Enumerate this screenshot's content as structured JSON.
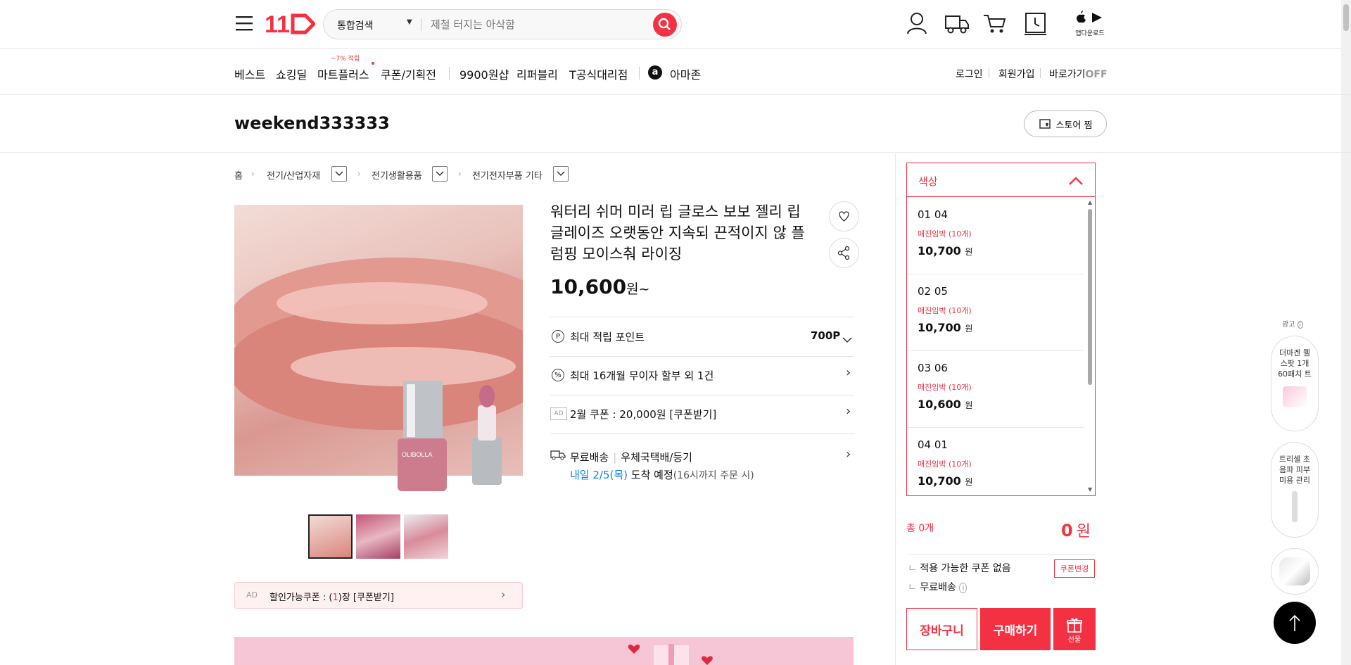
{
  "header": {
    "logo": "11",
    "search_category": "통합검색",
    "search_placeholder": "제철 터지는 아삭함",
    "app_download": "앱다운로드"
  },
  "nav": {
    "items": [
      "베스트",
      "쇼킹딜",
      "마트플러스",
      "쿠폰/기획전",
      "9900원샵",
      "리퍼블리",
      "T공식대리점",
      "아마존"
    ],
    "mart_badge": "~7% 적립",
    "login": "로그인",
    "signup": "회원가입",
    "shortcut": "바로가기",
    "shortcut_state": "OFF"
  },
  "store": {
    "name": "weekend333333",
    "follow_label": "스토어 찜"
  },
  "breadcrumb": [
    "홈",
    "전기/산업자재",
    "전기생활용품",
    "전기전자부품 기타"
  ],
  "product": {
    "title": "워터리 쉬머 미러 립 글로스 보보 젤리 립글레이즈 오랫동안 지속되 끈적이지 않 플럼핑 모이스춰 라이징",
    "price": "10,600",
    "price_unit": "원~",
    "point_label": "최대 적립 포인트",
    "point_value": "700P",
    "installment": "최대 16개월 무이자 할부 외 1건",
    "ad_tag": "AD",
    "coupon_row": "2월 쿠폰 : 20,000원 [쿠폰받기]",
    "shipping_label": "무료배송",
    "shipping_method": "우체국택배/등기",
    "arrival_date": "내일 2/5(목)",
    "arrival_text": "도착 예정",
    "arrival_note": "(16시까지 주문 시)",
    "brand_on_bottle": "OLIBOLLA"
  },
  "discount_coupon": {
    "ad": "AD",
    "prefix": "할인가능쿠폰 : (",
    "count": "1",
    "suffix": ")장 [쿠폰받기]"
  },
  "options": {
    "header": "색상",
    "items": [
      {
        "name": "01 04",
        "stock": "매진임박 (10개)",
        "price": "10,700",
        "unit": "원"
      },
      {
        "name": "02 05",
        "stock": "매진임박 (10개)",
        "price": "10,700",
        "unit": "원"
      },
      {
        "name": "03 06",
        "stock": "매진임박 (10개)",
        "price": "10,600",
        "unit": "원"
      },
      {
        "name": "04 01",
        "stock": "매진임박 (10개)",
        "price": "10,700",
        "unit": "원"
      }
    ]
  },
  "order": {
    "total_label": "총 0개",
    "total_value": "0",
    "total_unit": "원",
    "coupon_none": "적용 가능한 쿠폰 없음",
    "coupon_change": "쿠폰변경",
    "free_shipping": "무료배송",
    "cart_button": "장바구니",
    "buy_button": "구매하기",
    "gift_button": "선물"
  },
  "side_ads": {
    "label": "광고",
    "ad1": "더마겐 웰스팟 1개 60패치 트",
    "ad2": "트리셀 초음파 피부미용 관리"
  },
  "colors": {
    "brand": "#f43142",
    "blue": "#0b83e6"
  }
}
